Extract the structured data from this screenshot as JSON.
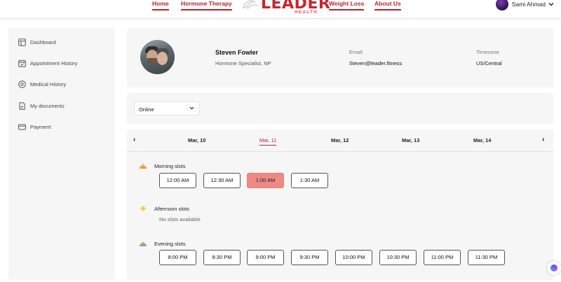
{
  "nav": {
    "links": [
      "Home",
      "Hormone Therapy",
      "Weight Loss",
      "About Us"
    ],
    "logo_main": "LEADER",
    "logo_sub": "HEALTH",
    "user_name": "Sami Ahmad",
    "user_chevron": "chevron-down-icon"
  },
  "sidebar": {
    "items": [
      {
        "label": "Dashboard",
        "icon": "dashboard-icon"
      },
      {
        "label": "Appointment History",
        "icon": "calendar-icon"
      },
      {
        "label": "Medical History",
        "icon": "medical-icon"
      },
      {
        "label": "My documents",
        "icon": "document-icon"
      },
      {
        "label": "Payment",
        "icon": "card-icon"
      }
    ]
  },
  "profile": {
    "name": "Steven Fowler",
    "role": "Hormone Specialist, NP",
    "email_label": "Email",
    "email": "Steven@leader.fitness",
    "timezone_label": "Timezone",
    "timezone": "US/Central"
  },
  "filter": {
    "mode": "Online"
  },
  "dates": {
    "items": [
      "Mar, 10",
      "Mar, 11",
      "Mar, 12",
      "Mar, 13",
      "Mar, 14"
    ],
    "active": "Mar, 11"
  },
  "slots": {
    "morning": {
      "title": "Morning slots",
      "times": [
        "12:00 AM",
        "12:30 AM",
        "1:00 AM",
        "1:30 AM"
      ],
      "selected": "1:00 AM"
    },
    "afternoon": {
      "title": "Afternoon slots",
      "empty_text": "No slots available"
    },
    "evening": {
      "title": "Evening slots",
      "times": [
        "8:00 PM",
        "8:30 PM",
        "9:00 PM",
        "9:30 PM",
        "10:00 PM",
        "10:30 PM",
        "11:00 PM",
        "11:30 PM"
      ]
    }
  },
  "colors": {
    "brand": "#b3262d",
    "selected_slot": "#ee8a83",
    "panel": "#f6f6f6"
  }
}
